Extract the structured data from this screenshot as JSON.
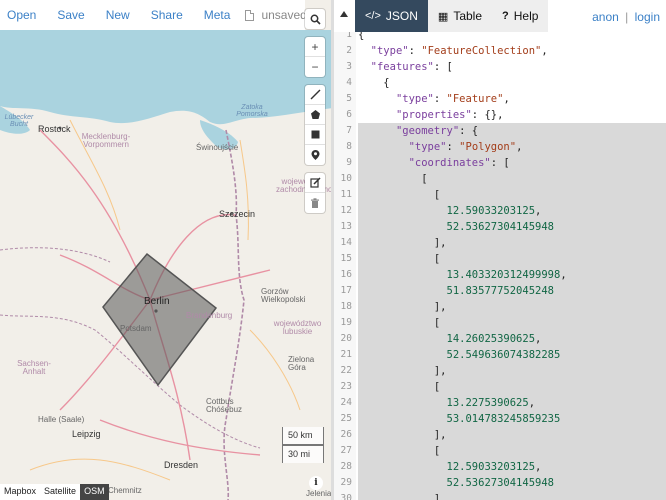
{
  "menu": {
    "items": [
      "Open",
      "Save",
      "New",
      "Share",
      "Meta"
    ],
    "file_status": "unsaved"
  },
  "map": {
    "scale": {
      "metric": "50 km",
      "imperial": "30 mi"
    },
    "layers": [
      {
        "label": "Mapbox",
        "active": false
      },
      {
        "label": "Satellite",
        "active": false
      },
      {
        "label": "OSM",
        "active": true
      }
    ],
    "labels": {
      "rostock": "Rostock",
      "mecklenburg": "Mecklenburg-Vorpommern",
      "swinoujscie": "Świnoujście",
      "lubecker": "Lübecker Bucht",
      "pomorska": "Zatoka Pomorska",
      "szczecin": "Szczecin",
      "zachodniopomorskie": "wojewó. zachodniopomorskie",
      "berlin": "Berlin",
      "potsdam": "Potsdam",
      "brandenburg": "Brandenburg",
      "gorzow": "Gorzów Wielkopolski",
      "lubuskie": "województwo lubuskie",
      "sachsen_anhalt": "Sachsen-Anhalt",
      "halle": "Halle (Saale)",
      "leipzig": "Leipzig",
      "cottbus": "Cottbus Chóśebuz",
      "zielona": "Zielona Góra",
      "dresden": "Dresden",
      "chemnitz": "Chemnitz",
      "jelenia": "Jelenia"
    },
    "polygon_color": "#555555"
  },
  "panel": {
    "tabs": [
      {
        "icon": "</>",
        "label": "JSON",
        "active": true
      },
      {
        "icon": "▦",
        "label": "Table",
        "active": false
      },
      {
        "icon": "?",
        "label": "Help",
        "active": false
      }
    ],
    "user": {
      "anon": "anon",
      "sep": "|",
      "login": "login"
    }
  },
  "editor": {
    "lines": [
      {
        "n": "1",
        "parts": [
          [
            "p",
            "{"
          ]
        ]
      },
      {
        "n": "2",
        "parts": [
          [
            "p",
            "  "
          ],
          [
            "k",
            "\"type\""
          ],
          [
            "p",
            ": "
          ],
          [
            "s",
            "\"FeatureCollection\""
          ],
          [
            "p",
            ","
          ]
        ]
      },
      {
        "n": "3",
        "parts": [
          [
            "p",
            "  "
          ],
          [
            "k",
            "\"features\""
          ],
          [
            "p",
            ": ["
          ]
        ]
      },
      {
        "n": "4",
        "parts": [
          [
            "p",
            "    {"
          ]
        ]
      },
      {
        "n": "5",
        "parts": [
          [
            "p",
            "      "
          ],
          [
            "k",
            "\"type\""
          ],
          [
            "p",
            ": "
          ],
          [
            "s",
            "\"Feature\""
          ],
          [
            "p",
            ","
          ]
        ]
      },
      {
        "n": "6",
        "parts": [
          [
            "p",
            "      "
          ],
          [
            "k",
            "\"properties\""
          ],
          [
            "p",
            ": {},"
          ]
        ]
      },
      {
        "n": "7",
        "parts": [
          [
            "p",
            "      "
          ],
          [
            "k",
            "\"geometry\""
          ],
          [
            "p",
            ": {"
          ]
        ],
        "sel": true
      },
      {
        "n": "8",
        "parts": [
          [
            "p",
            "        "
          ],
          [
            "k",
            "\"type\""
          ],
          [
            "p",
            ": "
          ],
          [
            "s",
            "\"Polygon\""
          ],
          [
            "p",
            ","
          ]
        ],
        "sel": true
      },
      {
        "n": "9",
        "parts": [
          [
            "p",
            "        "
          ],
          [
            "k",
            "\"coordinates\""
          ],
          [
            "p",
            ": ["
          ]
        ],
        "sel": true
      },
      {
        "n": "10",
        "parts": [
          [
            "p",
            "          ["
          ]
        ],
        "sel": true
      },
      {
        "n": "11",
        "parts": [
          [
            "p",
            "            ["
          ]
        ],
        "sel": true
      },
      {
        "n": "12",
        "parts": [
          [
            "p",
            "              "
          ],
          [
            "n",
            "12.59033203125"
          ],
          [
            "p",
            ","
          ]
        ],
        "sel": true
      },
      {
        "n": "13",
        "parts": [
          [
            "p",
            "              "
          ],
          [
            "n",
            "52.53627304145948"
          ]
        ],
        "sel": true
      },
      {
        "n": "14",
        "parts": [
          [
            "p",
            "            ],"
          ]
        ],
        "sel": true
      },
      {
        "n": "15",
        "parts": [
          [
            "p",
            "            ["
          ]
        ],
        "sel": true
      },
      {
        "n": "16",
        "parts": [
          [
            "p",
            "              "
          ],
          [
            "n",
            "13.403320312499998"
          ],
          [
            "p",
            ","
          ]
        ],
        "sel": true
      },
      {
        "n": "17",
        "parts": [
          [
            "p",
            "              "
          ],
          [
            "n",
            "51.83577752045248"
          ]
        ],
        "sel": true
      },
      {
        "n": "18",
        "parts": [
          [
            "p",
            "            ],"
          ]
        ],
        "sel": true
      },
      {
        "n": "19",
        "parts": [
          [
            "p",
            "            ["
          ]
        ],
        "sel": true
      },
      {
        "n": "20",
        "parts": [
          [
            "p",
            "              "
          ],
          [
            "n",
            "14.26025390625"
          ],
          [
            "p",
            ","
          ]
        ],
        "sel": true
      },
      {
        "n": "21",
        "parts": [
          [
            "p",
            "              "
          ],
          [
            "n",
            "52.549636074382285"
          ]
        ],
        "sel": true
      },
      {
        "n": "22",
        "parts": [
          [
            "p",
            "            ],"
          ]
        ],
        "sel": true
      },
      {
        "n": "23",
        "parts": [
          [
            "p",
            "            ["
          ]
        ],
        "sel": true
      },
      {
        "n": "24",
        "parts": [
          [
            "p",
            "              "
          ],
          [
            "n",
            "13.2275390625"
          ],
          [
            "p",
            ","
          ]
        ],
        "sel": true
      },
      {
        "n": "25",
        "parts": [
          [
            "p",
            "              "
          ],
          [
            "n",
            "53.014783245859235"
          ]
        ],
        "sel": true
      },
      {
        "n": "26",
        "parts": [
          [
            "p",
            "            ],"
          ]
        ],
        "sel": true
      },
      {
        "n": "27",
        "parts": [
          [
            "p",
            "            ["
          ]
        ],
        "sel": true
      },
      {
        "n": "28",
        "parts": [
          [
            "p",
            "              "
          ],
          [
            "n",
            "12.59033203125"
          ],
          [
            "p",
            ","
          ]
        ],
        "sel": true
      },
      {
        "n": "29",
        "parts": [
          [
            "p",
            "              "
          ],
          [
            "n",
            "52.53627304145948"
          ]
        ],
        "sel": true
      },
      {
        "n": "30",
        "parts": [
          [
            "p",
            "            ]"
          ]
        ],
        "sel": true
      }
    ]
  }
}
